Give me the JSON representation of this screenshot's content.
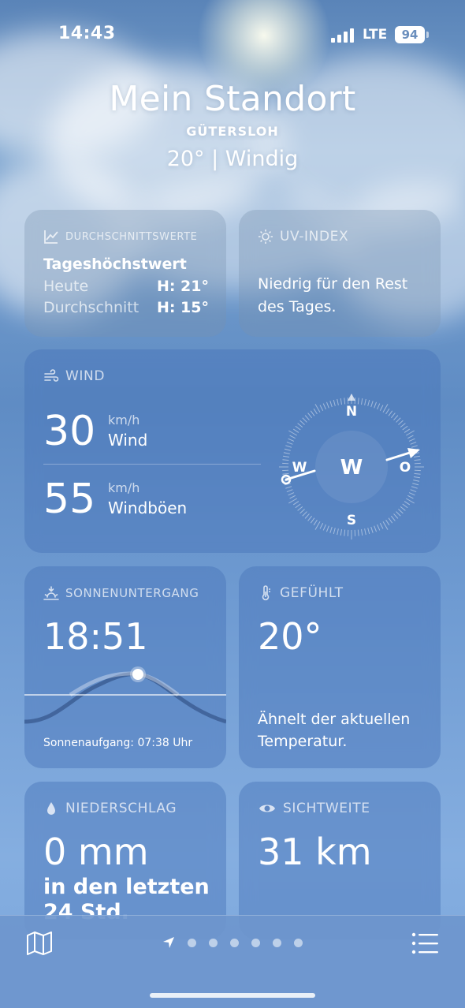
{
  "status_bar": {
    "time": "14:43",
    "network": "LTE",
    "battery": "94"
  },
  "header": {
    "location_title": "Mein Standort",
    "city": "GÜTERSLOH",
    "condition": "20°  |  Windig"
  },
  "averages": {
    "title": "DURCHSCHNITTSWERTE",
    "label": "Tageshöchstwert",
    "rows": [
      {
        "label": "Heute",
        "value": "H: 21°"
      },
      {
        "label": "Durchschnitt",
        "value": "H: 15°"
      }
    ]
  },
  "uv": {
    "title": "UV-INDEX",
    "text": "Niedrig für den Rest des Tages."
  },
  "wind": {
    "title": "WIND",
    "speed": "30",
    "speed_unit": "km/h",
    "speed_label": "Wind",
    "gust": "55",
    "gust_unit": "km/h",
    "gust_label": "Windböen",
    "compass": {
      "n": "N",
      "s": "S",
      "w": "W",
      "o": "O",
      "direction": "W"
    }
  },
  "sunset": {
    "title": "SONNENUNTERGANG",
    "time": "18:51",
    "sunrise": "Sonnenaufgang: 07:38 Uhr"
  },
  "feels": {
    "title": "GEFÜHLT",
    "value": "20°",
    "text": "Ähnelt der aktuellen Temperatur."
  },
  "precip": {
    "title": "NIEDERSCHLAG",
    "value": "0 mm",
    "sub": "in den letzten 24 Std."
  },
  "visibility": {
    "title": "SICHTWEITE",
    "value": "31 km"
  },
  "icons": {
    "map": "map-icon",
    "list": "list-icon",
    "location": "location-arrow-icon",
    "chart": "trend-chart-icon",
    "sun": "sun-icon",
    "wind": "wind-icon",
    "sunset": "sunset-icon",
    "thermometer": "thermometer-icon",
    "drop": "drop-icon",
    "eye": "eye-icon"
  },
  "pager": {
    "page_dots": 6
  }
}
